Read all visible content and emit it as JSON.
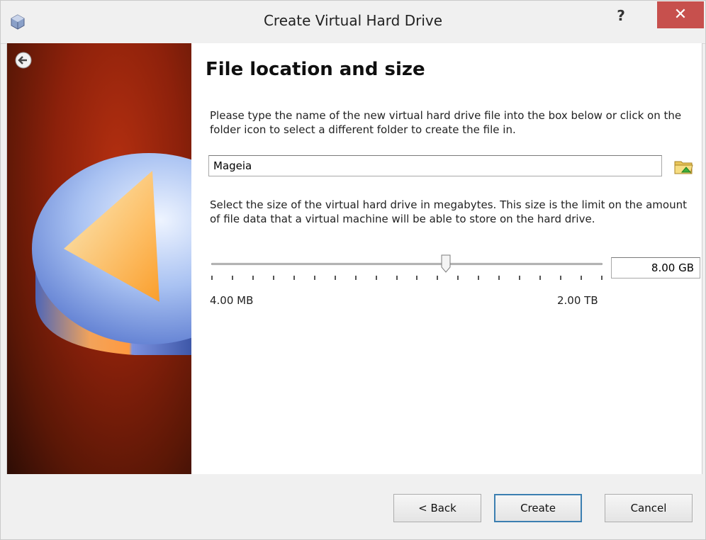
{
  "window": {
    "title": "Create Virtual Hard Drive",
    "help_label": "?",
    "close_label": "✕"
  },
  "page": {
    "heading": "File location and size",
    "location_description": "Please type the name of the new virtual hard drive file into the box below or click on the folder icon to select a different folder to create the file in.",
    "file_name": "Mageia",
    "size_description": "Select the size of the virtual hard drive in megabytes. This size is the limit on the amount of file data that a virtual machine will be able to store on the hard drive.",
    "size_slider": {
      "min_label": "4.00 MB",
      "max_label": "2.00 TB",
      "value_fraction": 0.6,
      "tick_count": 20
    },
    "size_value": "8.00 GB"
  },
  "buttons": {
    "back": "< Back",
    "create": "Create",
    "cancel": "Cancel"
  },
  "colors": {
    "close": "#c7504d",
    "accent": "#3c7fb1",
    "side_panel": "#8d210b"
  },
  "icons": {
    "app": "virtualbox-icon",
    "back": "back-arrow-icon",
    "folder": "folder-icon"
  }
}
